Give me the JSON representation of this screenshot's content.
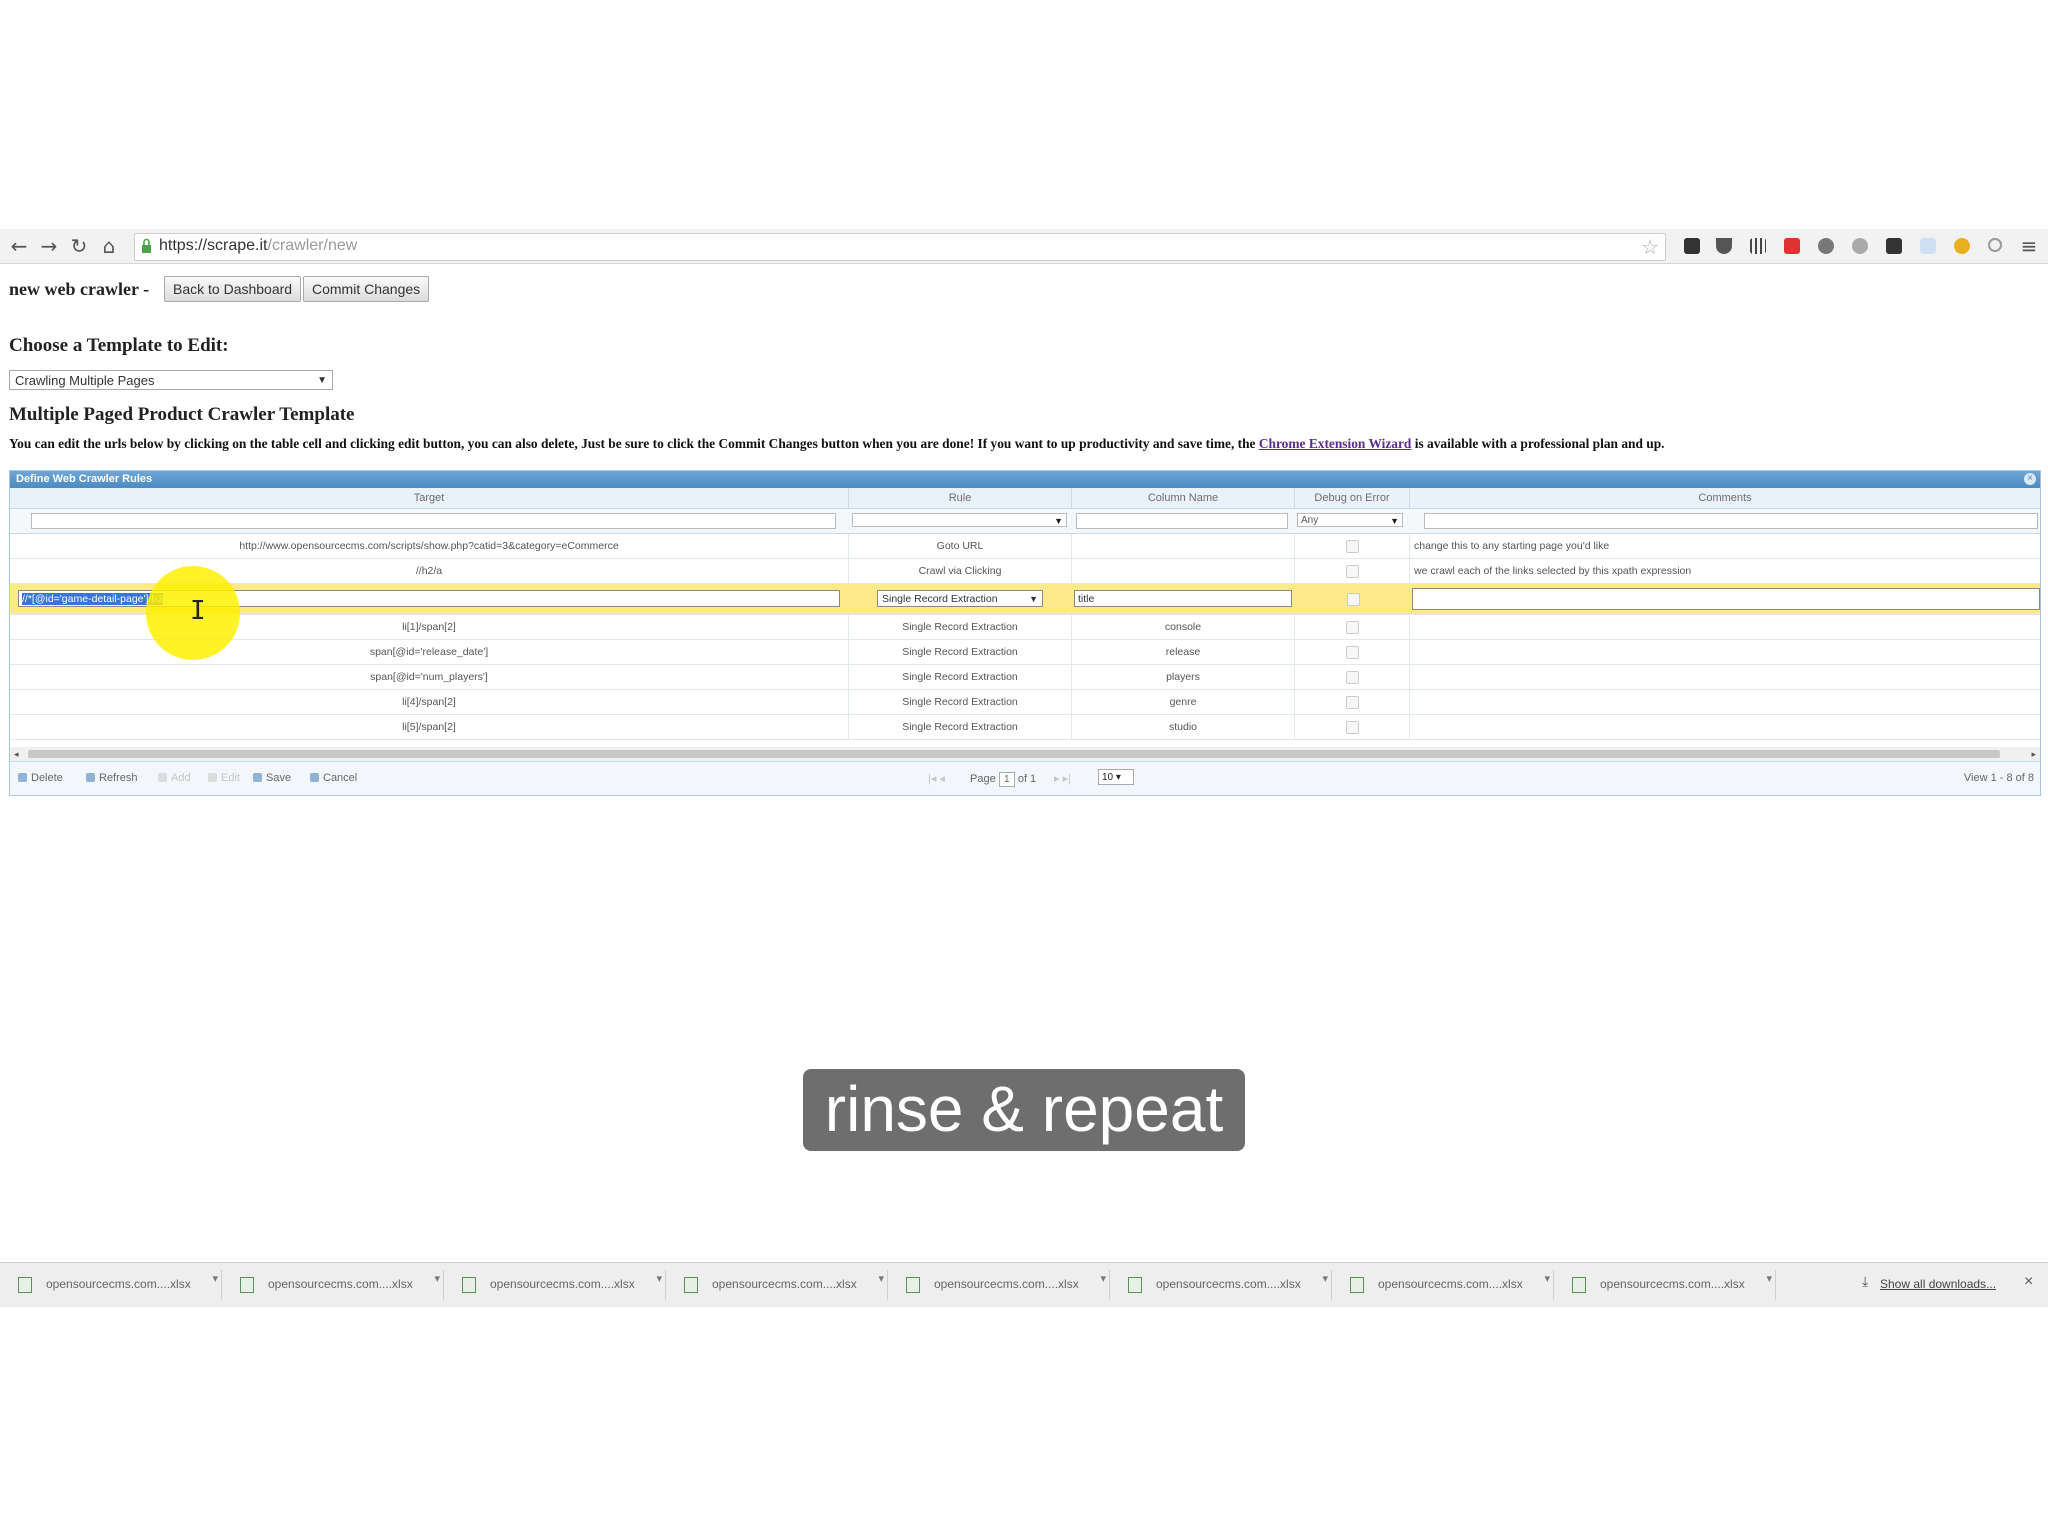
{
  "browser": {
    "url_host": "https://scrape.it",
    "url_path": "/crawler/new"
  },
  "page": {
    "title": "new web crawler -",
    "back_button": "Back to Dashboard",
    "commit_button": "Commit Changes",
    "choose_heading": "Choose a Template to Edit:",
    "template_select_value": "Crawling Multiple Pages",
    "template_heading": "Multiple Paged Product Crawler Template",
    "instructions_before": "You can edit the urls below by clicking on the table cell and clicking edit button, you can also delete, Just be sure to click the Commit Changes button when you are done! If you want to up productivity and save time, the ",
    "instructions_link": "Chrome Extension Wizard",
    "instructions_after": " is available with a professional plan and up."
  },
  "grid": {
    "caption": "Define Web Crawler Rules",
    "columns": {
      "target": "Target",
      "rule": "Rule",
      "column_name": "Column Name",
      "debug": "Debug on Error",
      "comments": "Comments"
    },
    "filter_debug_value": "Any",
    "rows": [
      {
        "target": "http://www.opensourcecms.com/scripts/show.php?catid=3&category=eCommerce",
        "rule": "Goto URL",
        "column": "",
        "comment": "change this to any starting page you'd like"
      },
      {
        "target": "//h2/a",
        "rule": "Crawl via Clicking",
        "column": "",
        "comment": "we crawl each of the links selected by this xpath expression"
      },
      {
        "target": "//*[@id='game-detail-page']/h3",
        "rule": "Single Record Extraction",
        "column": "title",
        "comment": ""
      },
      {
        "target": "li[1]/span[2]",
        "rule": "Single Record Extraction",
        "column": "console",
        "comment": ""
      },
      {
        "target": "span[@id='release_date']",
        "rule": "Single Record Extraction",
        "column": "release",
        "comment": ""
      },
      {
        "target": "span[@id='num_players']",
        "rule": "Single Record Extraction",
        "column": "players",
        "comment": ""
      },
      {
        "target": "li[4]/span[2]",
        "rule": "Single Record Extraction",
        "column": "genre",
        "comment": ""
      },
      {
        "target": "li[5]/span[2]",
        "rule": "Single Record Extraction",
        "column": "studio",
        "comment": ""
      }
    ],
    "pager": {
      "delete": "Delete",
      "refresh": "Refresh",
      "add": "Add",
      "edit": "Edit",
      "save": "Save",
      "cancel": "Cancel",
      "page_label": "Page",
      "page_number": "1",
      "of_label": "of 1",
      "rows_per_page": "10",
      "view_info": "View 1 - 8 of 8"
    }
  },
  "caption": "rinse & repeat",
  "downloads": {
    "items": [
      "opensourcecms.com....xlsx",
      "opensourcecms.com....xlsx",
      "opensourcecms.com....xlsx",
      "opensourcecms.com....xlsx",
      "opensourcecms.com....xlsx",
      "opensourcecms.com....xlsx",
      "opensourcecms.com....xlsx",
      "opensourcecms.com....xlsx"
    ],
    "show_all": "Show all downloads..."
  },
  "colors": {
    "editing_row": "#fbe98a",
    "grid_caption": "#4b8ac2",
    "cursor_highlight": "#fff000",
    "link": "#5b2b8e"
  }
}
